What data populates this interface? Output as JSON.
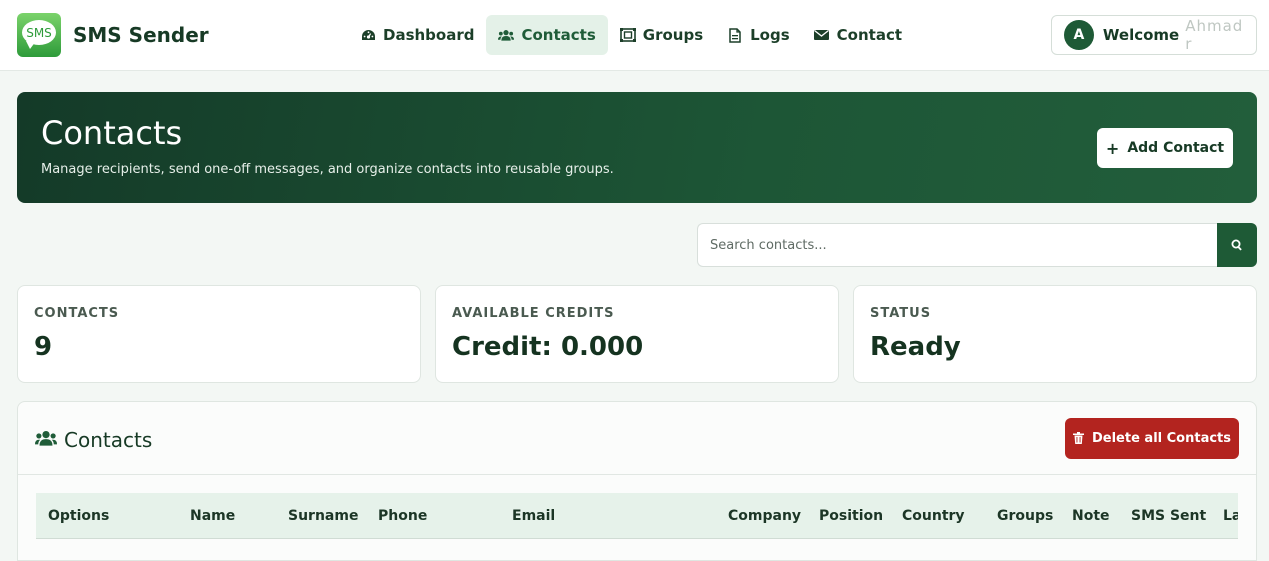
{
  "brand": {
    "logo_text": "SMS",
    "name": "SMS Sender"
  },
  "nav": {
    "items": [
      {
        "label": "Dashboard",
        "icon": "dashboard-icon",
        "active": false
      },
      {
        "label": "Contacts",
        "icon": "users-icon",
        "active": true
      },
      {
        "label": "Groups",
        "icon": "groups-icon",
        "active": false
      },
      {
        "label": "Logs",
        "icon": "file-icon",
        "active": false
      },
      {
        "label": "Contact",
        "icon": "envelope-icon",
        "active": false
      }
    ]
  },
  "user": {
    "avatar_initial": "A",
    "welcome": "Welcome",
    "name": "Ahmad r"
  },
  "hero": {
    "title": "Contacts",
    "subtitle": "Manage recipients, send one-off messages, and organize contacts into reusable groups.",
    "add_button": "Add Contact"
  },
  "search": {
    "placeholder": "Search contacts..."
  },
  "stats": [
    {
      "label": "CONTACTS",
      "value": "9"
    },
    {
      "label": "AVAILABLE CREDITS",
      "value": "Credit: 0.000"
    },
    {
      "label": "STATUS",
      "value": "Ready"
    }
  ],
  "panel": {
    "title": "Contacts",
    "delete_button": "Delete all Contacts",
    "columns": [
      "Options",
      "Name",
      "Surname",
      "Phone",
      "Email",
      "Company",
      "Position",
      "Country",
      "Groups",
      "Note",
      "SMS Sent",
      "La"
    ]
  },
  "colors": {
    "primary": "#1e5a36",
    "danger": "#b3241f",
    "active_nav_bg": "#e4f1e8"
  }
}
